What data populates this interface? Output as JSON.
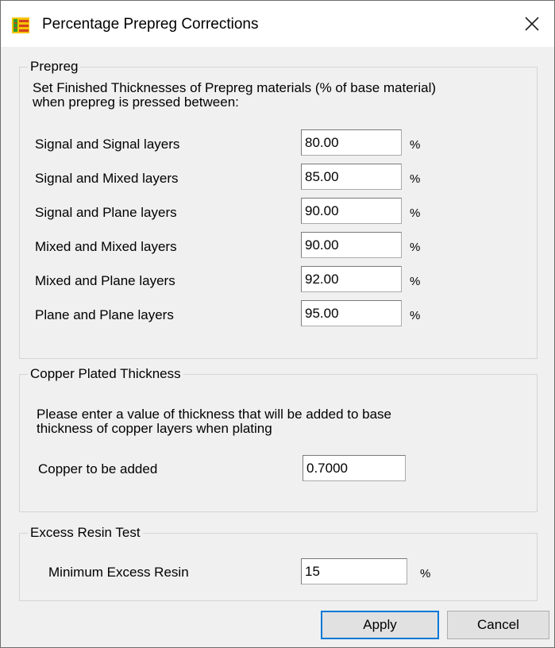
{
  "window": {
    "title": "Percentage Prepreg Corrections"
  },
  "prepreg": {
    "legend": "Prepreg",
    "description_line1": "Set Finished Thicknesses of Prepreg materials  (% of base material)",
    "description_line2": "when prepreg is pressed between:",
    "rows": [
      {
        "label": "Signal and Signal layers",
        "value": "80.00",
        "unit": "%"
      },
      {
        "label": "Signal and Mixed layers",
        "value": "85.00",
        "unit": "%"
      },
      {
        "label": "Signal and Plane layers",
        "value": "90.00",
        "unit": "%"
      },
      {
        "label": "Mixed and Mixed layers",
        "value": "90.00",
        "unit": "%"
      },
      {
        "label": "Mixed and Plane layers",
        "value": "92.00",
        "unit": "%"
      },
      {
        "label": "Plane and Plane layers",
        "value": "95.00",
        "unit": "%"
      }
    ]
  },
  "copper": {
    "legend": "Copper Plated Thickness",
    "description_line1": "Please enter a value of thickness that will be added to base",
    "description_line2": "thickness of copper layers when plating",
    "label": "Copper to be added",
    "value": "0.7000"
  },
  "resin": {
    "legend": "Excess Resin Test",
    "label": "Minimum Excess Resin",
    "value": "15",
    "unit": "%"
  },
  "buttons": {
    "apply": "Apply",
    "cancel": "Cancel"
  },
  "icons": {
    "app": "stackup-icon",
    "close": "close-icon"
  }
}
